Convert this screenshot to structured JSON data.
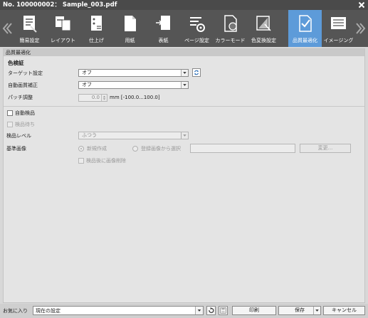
{
  "window": {
    "title": "No. 100000002： Sample_003.pdf",
    "close": "✕"
  },
  "toolbar": {
    "nav_left": "«",
    "nav_right": "»",
    "items": [
      {
        "label": "簡易設定",
        "icon": "basic-settings-icon"
      },
      {
        "label": "レイアウト",
        "icon": "layout-icon"
      },
      {
        "label": "仕上げ",
        "icon": "finishing-icon"
      },
      {
        "label": "用紙",
        "icon": "paper-icon"
      },
      {
        "label": "表紙",
        "icon": "cover-icon"
      },
      {
        "label": "ページ設定",
        "icon": "page-settings-icon"
      },
      {
        "label": "カラーモード",
        "icon": "color-mode-icon"
      },
      {
        "label": "色変換設定",
        "icon": "color-conversion-icon"
      },
      {
        "label": "品質最適化",
        "icon": "quality-optimization-icon",
        "active": true
      },
      {
        "label": "イメージング",
        "icon": "imaging-icon"
      }
    ],
    "active_color": "#5d9bd9"
  },
  "panel": {
    "section_title": "品質最適化",
    "color_verify": {
      "title": "色検証",
      "target_label": "ターゲット設定",
      "target_value": "オフ",
      "auto_correct_label": "自動画質補正",
      "auto_correct_value": "オフ",
      "patch_label": "パッチ調整",
      "patch_value": "0.0",
      "patch_range": "mm [-100.0...100.0]"
    },
    "inspection": {
      "auto_inspect_label": "自動検品",
      "wait_label": "検品待ち",
      "level_label": "検品レベル",
      "level_value": "ふつう",
      "reference_label": "基準画像",
      "new_label": "新規作成",
      "select_label": "登録画像から選択",
      "change_button": "変更...",
      "delete_after_label": "検品後に画像削除"
    }
  },
  "bottom": {
    "favorites_label": "お気に入り",
    "favorites_value": "現在の設定",
    "print": "印刷",
    "save": "保存",
    "cancel": "キャンセル"
  }
}
